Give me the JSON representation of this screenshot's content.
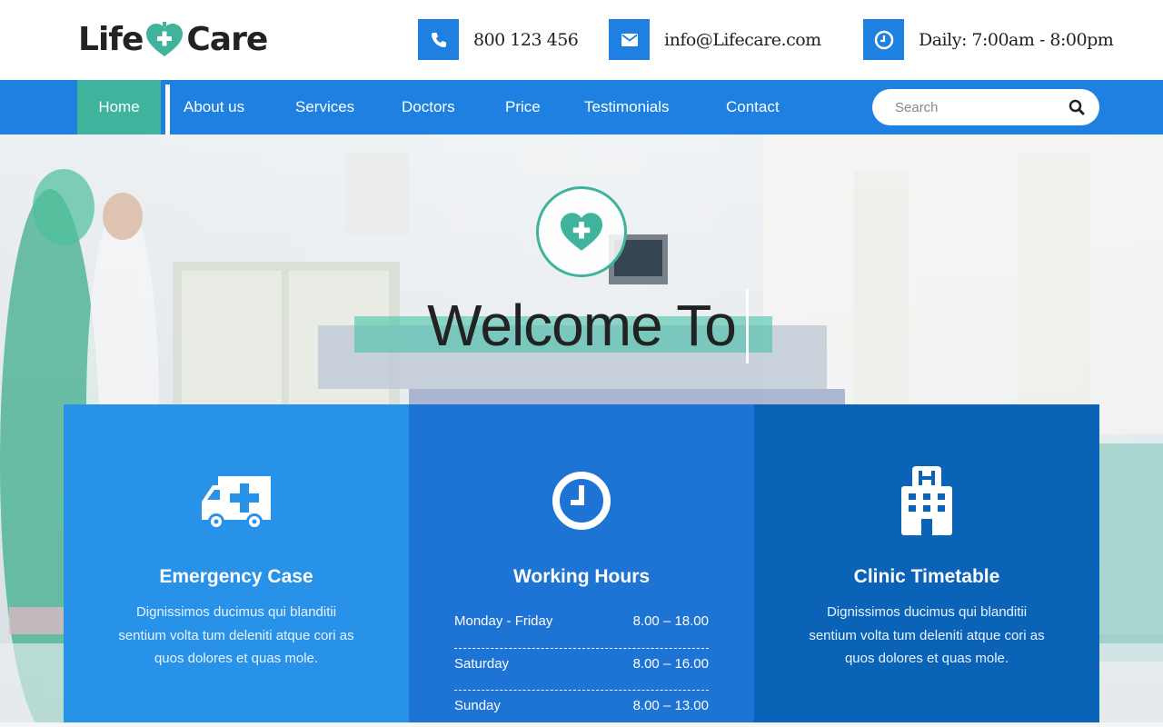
{
  "brand": {
    "left": "Life",
    "right": "Care"
  },
  "contacts": {
    "phone": {
      "icon": "phone-icon",
      "text": "800 123 456"
    },
    "email": {
      "icon": "envelope-icon",
      "text": "info@Lifecare.com"
    },
    "hours": {
      "icon": "clock-icon",
      "text": "Daily: 7:00am - 8:00pm"
    }
  },
  "nav": {
    "items": [
      {
        "label": "Home",
        "active": true
      },
      {
        "label": "About us"
      },
      {
        "label": "Services"
      },
      {
        "label": "Doctors"
      },
      {
        "label": "Price"
      },
      {
        "label": "Testimonials"
      },
      {
        "label": "Contact"
      }
    ],
    "search_placeholder": "Search"
  },
  "hero": {
    "title": "Welcome To",
    "badge_icon": "heart-plus-icon"
  },
  "cards": [
    {
      "icon": "ambulance-icon",
      "title": "Emergency Case",
      "text": "Dignissimos ducimus qui blanditii sentium volta tum deleniti atque cori as quos dolores et quas mole."
    },
    {
      "icon": "clock-icon",
      "title": "Working Hours",
      "hours": [
        {
          "day": "Monday - Friday",
          "time": "8.00 – 18.00"
        },
        {
          "day": "Saturday",
          "time": "8.00 – 16.00"
        },
        {
          "day": "Sunday",
          "time": "8.00 – 13.00"
        }
      ]
    },
    {
      "icon": "hospital-icon",
      "title": "Clinic Timetable",
      "text": "Dignissimos ducimus qui blanditii sentium volta tum deleniti atque cori as quos dolores et quas mole."
    }
  ],
  "colors": {
    "primary": "#1e80e0",
    "accent": "#3fb39b",
    "card1": "#2892e8",
    "card2": "#1e74d4",
    "card3": "#0b63b8"
  }
}
